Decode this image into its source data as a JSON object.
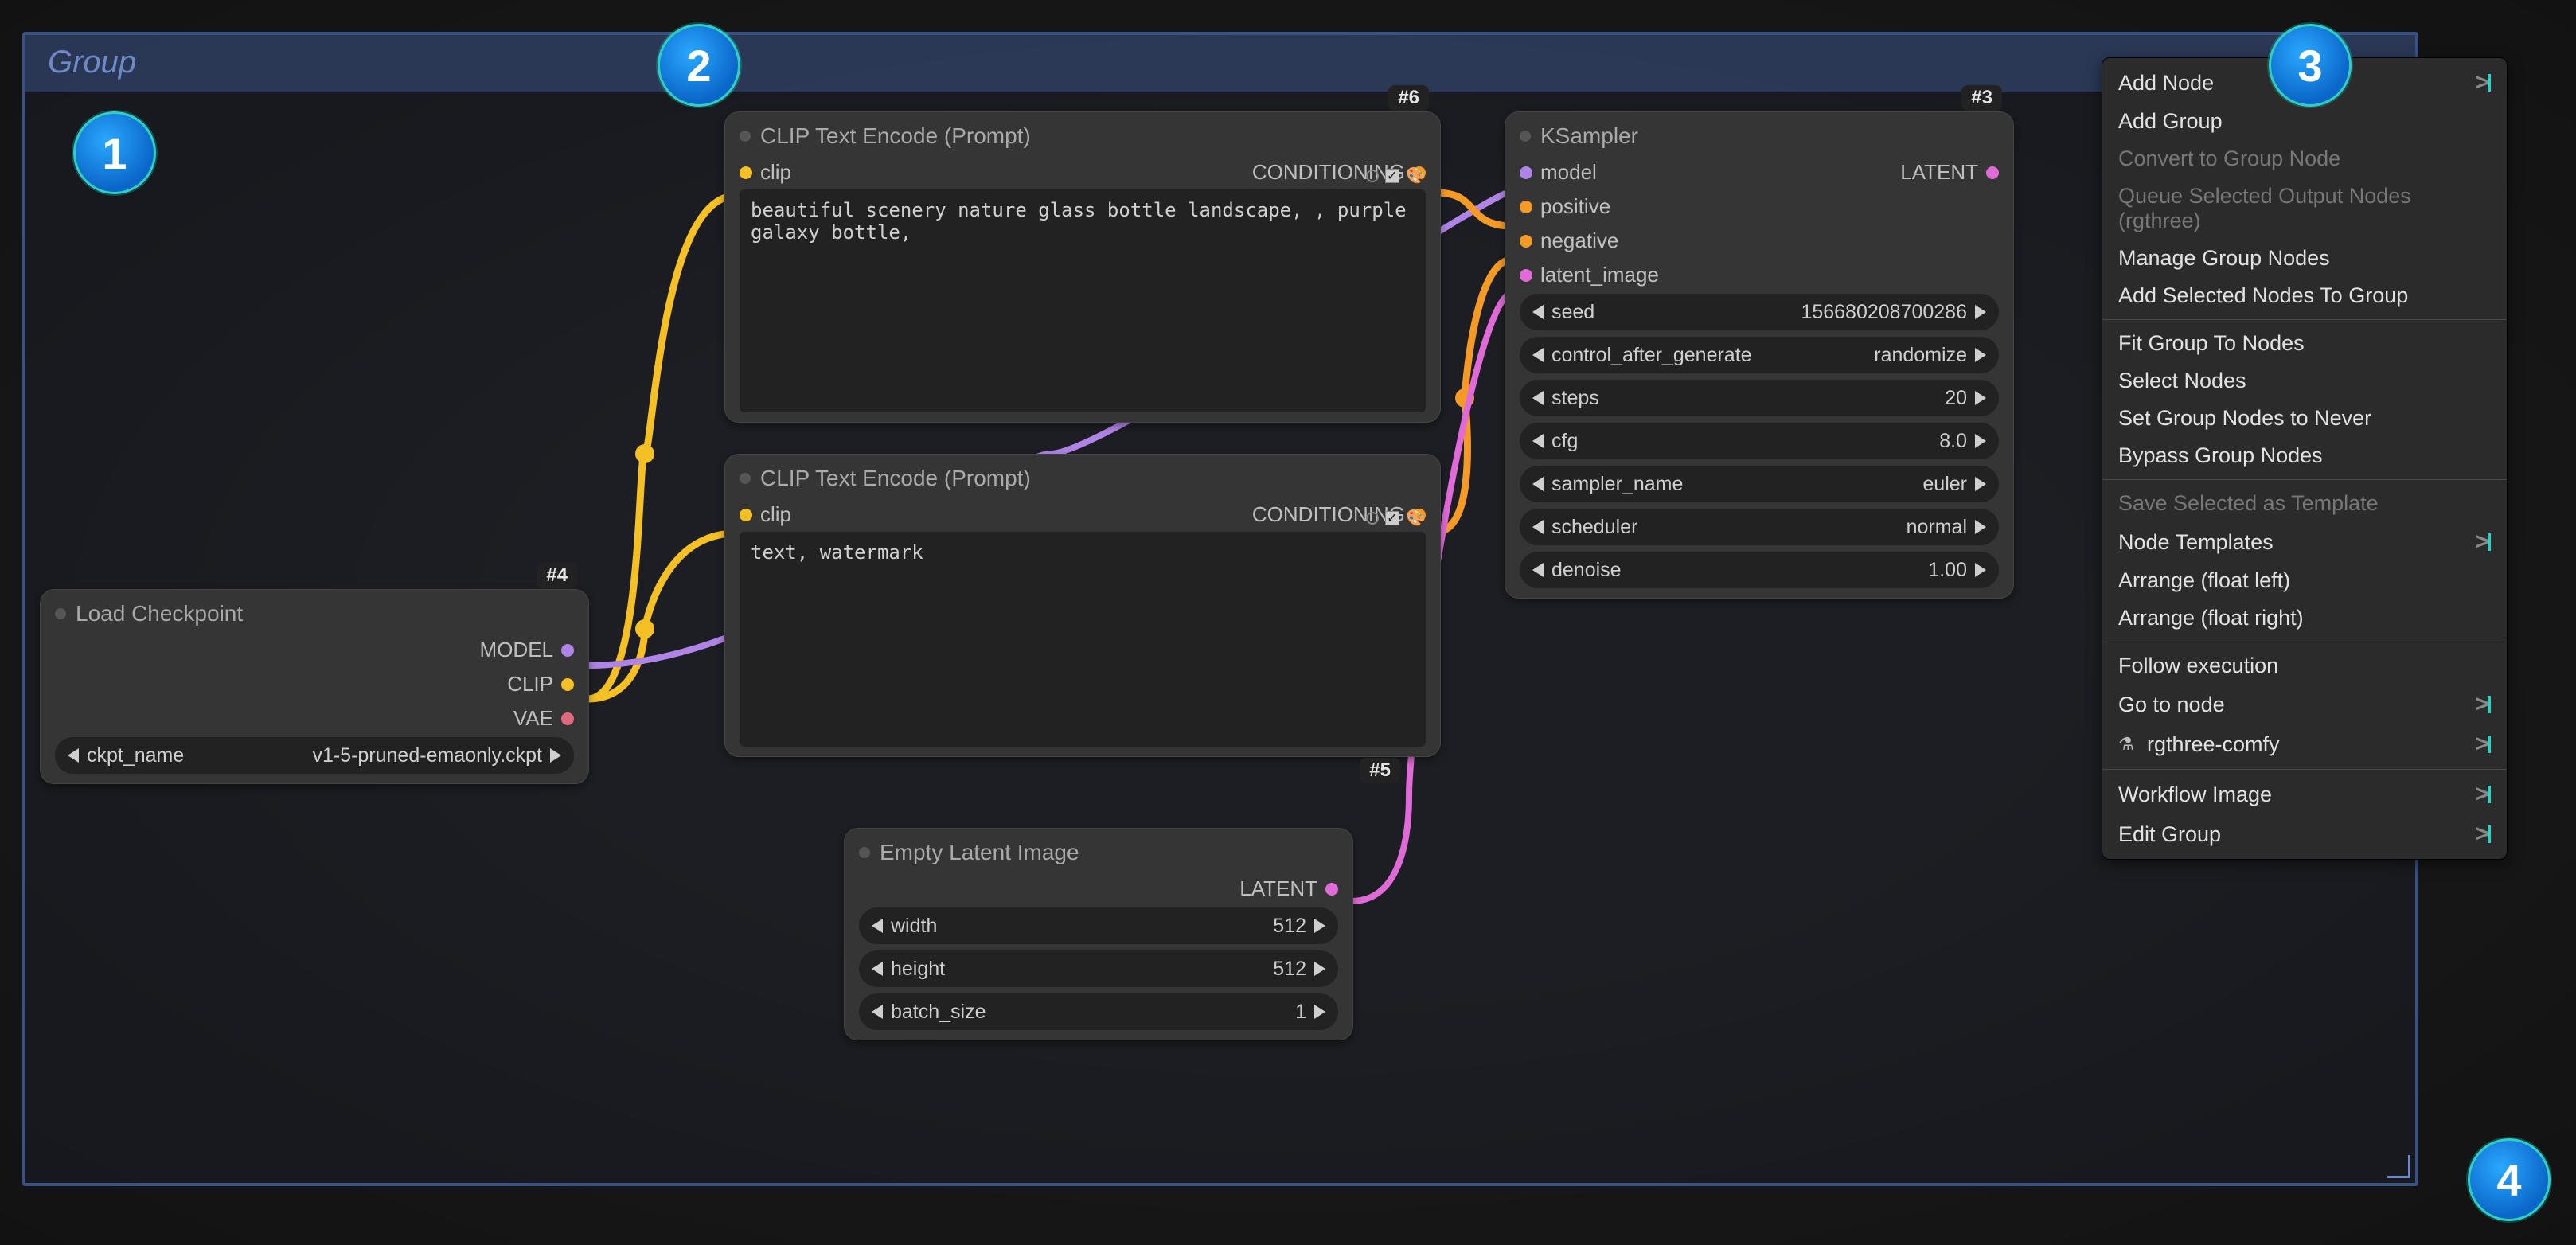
{
  "group": {
    "title": "Group"
  },
  "callouts": {
    "c1": "1",
    "c2": "2",
    "c3": "3",
    "c4": "4"
  },
  "nodes": {
    "load_ckpt": {
      "id_badge": "#4",
      "title": "Load Checkpoint",
      "outputs": {
        "model": "MODEL",
        "clip": "CLIP",
        "vae": "VAE"
      },
      "widget": {
        "name": "ckpt_name",
        "value": "v1-5-pruned-emaonly.ckpt"
      }
    },
    "clip_pos": {
      "id_badge": "#6",
      "title": "CLIP Text Encode (Prompt)",
      "inputs": {
        "clip": "clip"
      },
      "outputs": {
        "cond": "CONDITIONING"
      },
      "prompt": "beautiful scenery nature glass bottle landscape, , purple galaxy bottle,"
    },
    "clip_neg": {
      "id_badge": "#5",
      "title": "CLIP Text Encode (Prompt)",
      "inputs": {
        "clip": "clip"
      },
      "outputs": {
        "cond": "CONDITIONING"
      },
      "prompt": "text, watermark"
    },
    "empty_latent": {
      "title": "Empty Latent Image",
      "outputs": {
        "latent": "LATENT"
      },
      "widgets": {
        "width": {
          "name": "width",
          "value": "512"
        },
        "height": {
          "name": "height",
          "value": "512"
        },
        "batch_size": {
          "name": "batch_size",
          "value": "1"
        }
      }
    },
    "ksampler": {
      "id_badge": "#3",
      "title": "KSampler",
      "inputs": {
        "model": "model",
        "positive": "positive",
        "negative": "negative",
        "latent_image": "latent_image"
      },
      "outputs": {
        "latent": "LATENT"
      },
      "widgets": {
        "seed": {
          "name": "seed",
          "value": "156680208700286"
        },
        "ctrl": {
          "name": "control_after_generate",
          "value": "randomize"
        },
        "steps": {
          "name": "steps",
          "value": "20"
        },
        "cfg": {
          "name": "cfg",
          "value": "8.0"
        },
        "sampler": {
          "name": "sampler_name",
          "value": "euler"
        },
        "scheduler": {
          "name": "scheduler",
          "value": "normal"
        },
        "denoise": {
          "name": "denoise",
          "value": "1.00"
        }
      }
    }
  },
  "context_menu": {
    "add_node": "Add Node",
    "add_group": "Add Group",
    "convert_group_node": "Convert to Group Node",
    "queue_selected": "Queue Selected Output Nodes (rgthree)",
    "manage_group_nodes": "Manage Group Nodes",
    "add_selected_to_group": "Add Selected Nodes To Group",
    "fit_group": "Fit Group To Nodes",
    "select_nodes": "Select Nodes",
    "set_group_never": "Set Group Nodes to Never",
    "bypass_group": "Bypass Group Nodes",
    "save_template": "Save Selected as Template",
    "node_templates": "Node Templates",
    "arrange_left": "Arrange (float left)",
    "arrange_right": "Arrange (float right)",
    "follow_exec": "Follow execution",
    "go_to_node": "Go to node",
    "rgthree": "rgthree-comfy",
    "workflow_image": "Workflow Image",
    "edit_group": "Edit Group"
  },
  "colors": {
    "model": "#b083e6",
    "clip": "#f5c024",
    "vae": "#e06a7b",
    "cond": "#f59a24",
    "latent": "#e06ad7"
  }
}
